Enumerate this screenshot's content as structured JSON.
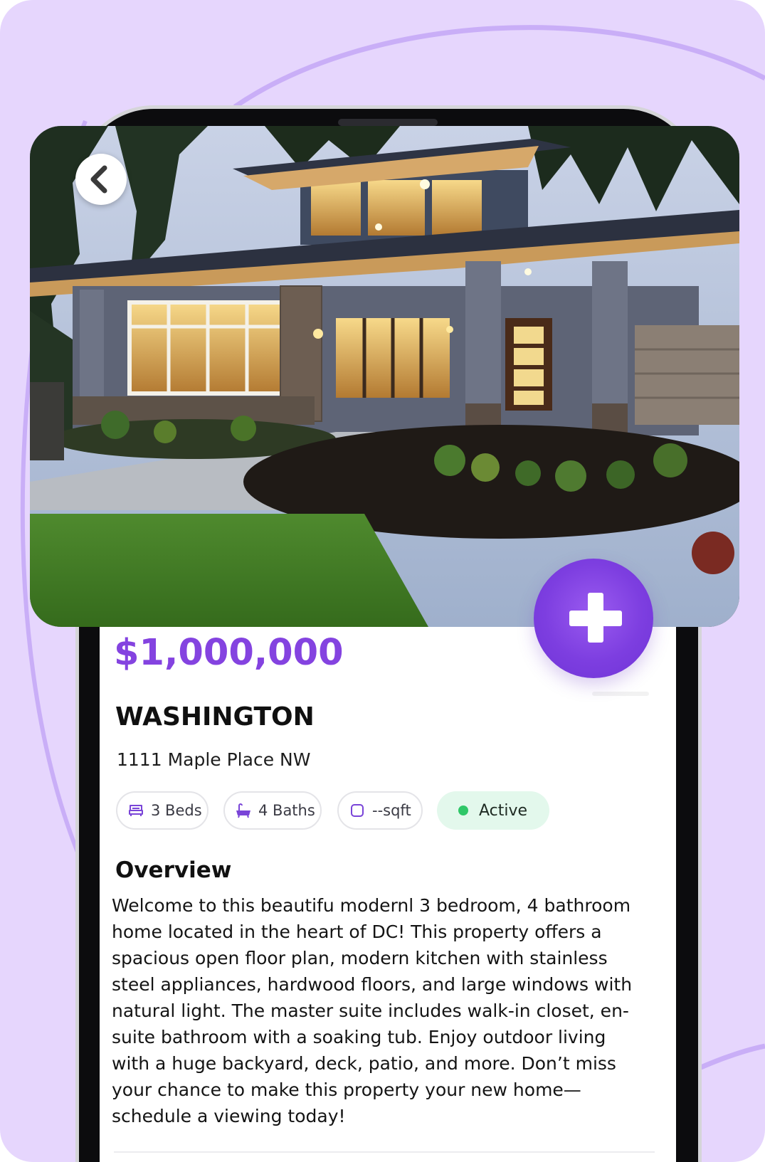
{
  "listing": {
    "price": "$1,000,000",
    "city": "WASHINGTON",
    "address": "1111 Maple Place NW"
  },
  "features": {
    "beds": "3 Beds",
    "baths": "4 Baths",
    "sqft": "--sqft",
    "status": "Active"
  },
  "overview": {
    "title": "Overview",
    "lines": [
      "Welcome to this beautifu modernl 3 bedroom, 4 bathroom",
      "home located in the heart of DC! This property offers a",
      "spacious open floor plan, modern kitchen with stainless",
      "steel appliances, hardwood floors, and large windows with",
      "natural light. The master suite includes walk-in closet, en-",
      "suite bathroom with a soaking tub. Enjoy outdoor living",
      "with a huge backyard, deck, patio, and more. Don’t miss",
      "your chance to make this property your new home—",
      "schedule a viewing today!"
    ]
  },
  "icons": {
    "back": "chevron-left-icon",
    "add": "plus-icon",
    "beds": "bed-icon",
    "baths": "bathtub-icon",
    "sqft": "square-icon",
    "status": "status-dot"
  },
  "colors": {
    "background": "#e6d6fd",
    "accent": "#8443e0",
    "status_bg": "#e3f8ec",
    "status_dot": "#2fc768"
  }
}
